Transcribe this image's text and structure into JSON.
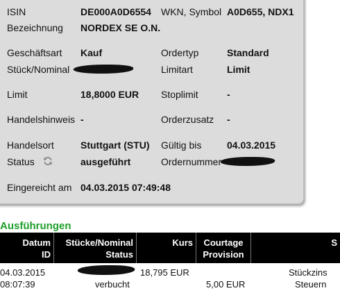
{
  "order": {
    "isin_label": "ISIN",
    "isin_value": "DE000A0D6554",
    "wkn_label": "WKN, Symbol",
    "wkn_value": "A0D655, NDX1",
    "bezeichnung_label": "Bezeichnung",
    "bezeichnung_value": "NORDEX SE O.N.",
    "geschaeftsart_label": "Geschäftsart",
    "geschaeftsart_value": "Kauf",
    "ordertyp_label": "Ordertyp",
    "ordertyp_value": "Standard",
    "stueck_label": "Stück/Nominal",
    "limitart_label": "Limitart",
    "limitart_value": "Limit",
    "limit_label": "Limit",
    "limit_value": "18,8000 EUR",
    "stoplimit_label": "Stoplimit",
    "stoplimit_value": "-",
    "handelshinweis_label": "Handelshinweis",
    "handelshinweis_value": "-",
    "orderzusatz_label": "Orderzusatz",
    "orderzusatz_value": "-",
    "handelsort_label": "Handelsort",
    "handelsort_value": "Stuttgart (STU)",
    "gueltig_label": "Gültig bis",
    "gueltig_value": "04.03.2015",
    "status_label": "Status",
    "status_value": "ausgeführt",
    "ordernummer_label": "Ordernummer",
    "eingereicht_label": "Eingereicht am",
    "eingereicht_value": "04.03.2015 07:49:48",
    "refresh_icon": "refresh-icon"
  },
  "executions": {
    "title": "Ausführungen",
    "headers": {
      "datum_line1": "Datum",
      "datum_line2": "ID",
      "stueck_line1": "Stücke/Nominal",
      "stueck_line2": "Status",
      "kurs": "Kurs",
      "courtage_line1": "Courtage",
      "courtage_line2": "Provision",
      "last_partial": "S"
    },
    "rows": [
      {
        "date": "04.03.2015",
        "time": "08:07:39",
        "status": "verbucht",
        "kurs": "18,795 EUR",
        "provision": "5,00 EUR",
        "cost_label_1": "Stückzins",
        "cost_label_2": "Steuern"
      }
    ]
  },
  "colors": {
    "panel_background": "#dcdcdc",
    "section_title": "#1e9e2a",
    "table_header": "#000000"
  }
}
